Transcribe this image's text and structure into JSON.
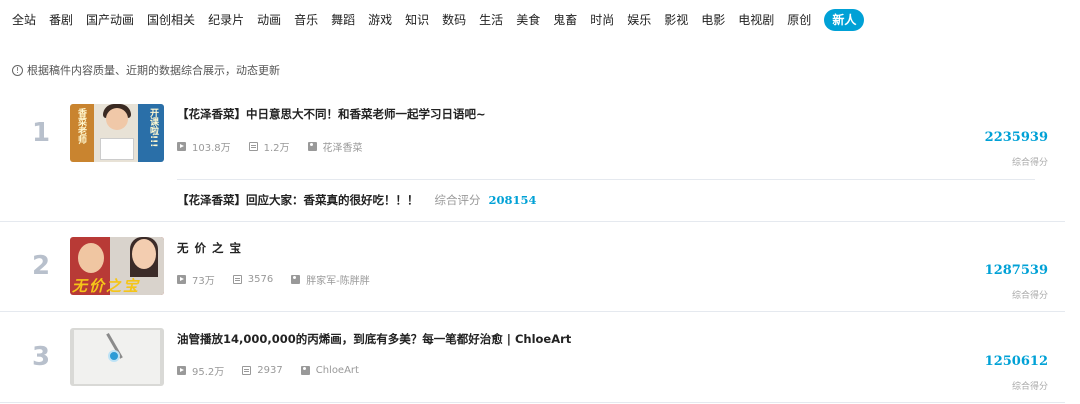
{
  "tabs": [
    "全站",
    "番剧",
    "国产动画",
    "国创相关",
    "纪录片",
    "动画",
    "音乐",
    "舞蹈",
    "游戏",
    "知识",
    "数码",
    "生活",
    "美食",
    "鬼畜",
    "时尚",
    "娱乐",
    "影视",
    "电影",
    "电视剧",
    "原创",
    "新人"
  ],
  "active_tab": "新人",
  "notice": "根据稿件内容质量、近期的数据综合展示，动态更新",
  "score_label": "综合得分",
  "items": [
    {
      "rank": "1",
      "title": "【花泽香菜】中日意思大不同！和香菜老师一起学习日语吧~",
      "plays": "103.8万",
      "danmaku": "1.2万",
      "uploader": "花泽香菜",
      "score": "2235939",
      "thumb_text_left": "香菜老师",
      "thumb_text_right": "开课啦!!!"
    },
    {
      "rank": "2",
      "title": "无 价 之 宝",
      "plays": "73万",
      "danmaku": "3576",
      "uploader": "胖家军-陈胖胖",
      "score": "1287539",
      "thumb_caption": "无价之宝"
    },
    {
      "rank": "3",
      "title": "油管播放14,000,000的丙烯画，到底有多美？每一笔都好治愈 | ChloeArt",
      "plays": "95.2万",
      "danmaku": "2937",
      "uploader": "ChloeArt",
      "score": "1250612"
    }
  ],
  "related": {
    "title": "【花泽香菜】回应大家：香菜真的很好吃！！！",
    "label": "综合评分",
    "score": "208154"
  },
  "colors": {
    "accent": "#00a1d6",
    "rank_number": "#b8c0cc"
  }
}
